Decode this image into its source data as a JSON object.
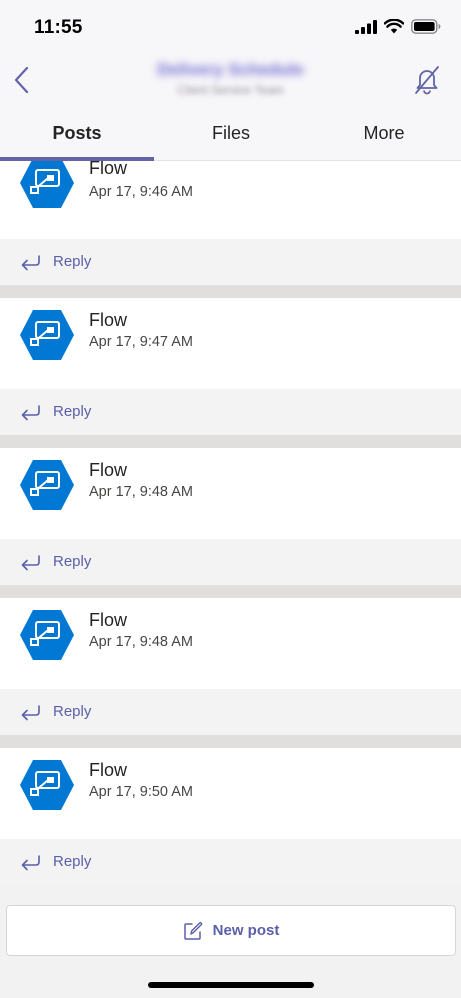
{
  "status_bar": {
    "time": "11:55",
    "icons": [
      "signal-icon",
      "wifi-icon",
      "battery-icon"
    ]
  },
  "header": {
    "title": "Delivery Schedule",
    "subtitle": "Client Service Team",
    "back_icon": "chevron-left-icon",
    "mute_icon": "bell-off-icon"
  },
  "tabs": [
    {
      "label": "Posts",
      "active": true
    },
    {
      "label": "Files",
      "active": false
    },
    {
      "label": "More",
      "active": false
    }
  ],
  "posts": [
    {
      "author": "Flow",
      "time": "Apr 17, 9:46 AM",
      "reply_label": "Reply"
    },
    {
      "author": "Flow",
      "time": "Apr 17, 9:47 AM",
      "reply_label": "Reply"
    },
    {
      "author": "Flow",
      "time": "Apr 17, 9:48 AM",
      "reply_label": "Reply"
    },
    {
      "author": "Flow",
      "time": "Apr 17, 9:48 AM",
      "reply_label": "Reply"
    },
    {
      "author": "Flow",
      "time": "Apr 17, 9:50 AM",
      "reply_label": "Reply"
    }
  ],
  "composer": {
    "new_post_label": "New post",
    "icon": "compose-icon"
  },
  "colors": {
    "accent": "#6264a7",
    "reply_text": "#5b5fa8",
    "flow_icon": "#0078d4",
    "divider": "#e1dfdd"
  }
}
